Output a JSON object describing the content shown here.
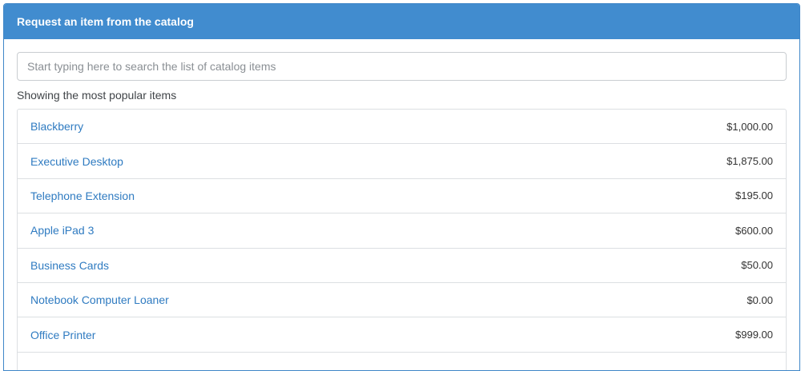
{
  "panel": {
    "title": "Request an item from the catalog"
  },
  "search": {
    "placeholder": "Start typing here to search the list of catalog items",
    "value": ""
  },
  "list": {
    "subtitle": "Showing the most popular items",
    "items": [
      {
        "name": "Blackberry",
        "price": "$1,000.00"
      },
      {
        "name": "Executive Desktop",
        "price": "$1,875.00"
      },
      {
        "name": "Telephone Extension",
        "price": "$195.00"
      },
      {
        "name": "Apple iPad 3",
        "price": "$600.00"
      },
      {
        "name": "Business Cards",
        "price": "$50.00"
      },
      {
        "name": "Notebook Computer Loaner",
        "price": "$0.00"
      },
      {
        "name": "Office Printer",
        "price": "$999.00"
      },
      {
        "name": "",
        "price": ""
      }
    ]
  },
  "colors": {
    "header_bg": "#418ccf",
    "link": "#2f7bc1",
    "border": "#dcdfe2"
  }
}
